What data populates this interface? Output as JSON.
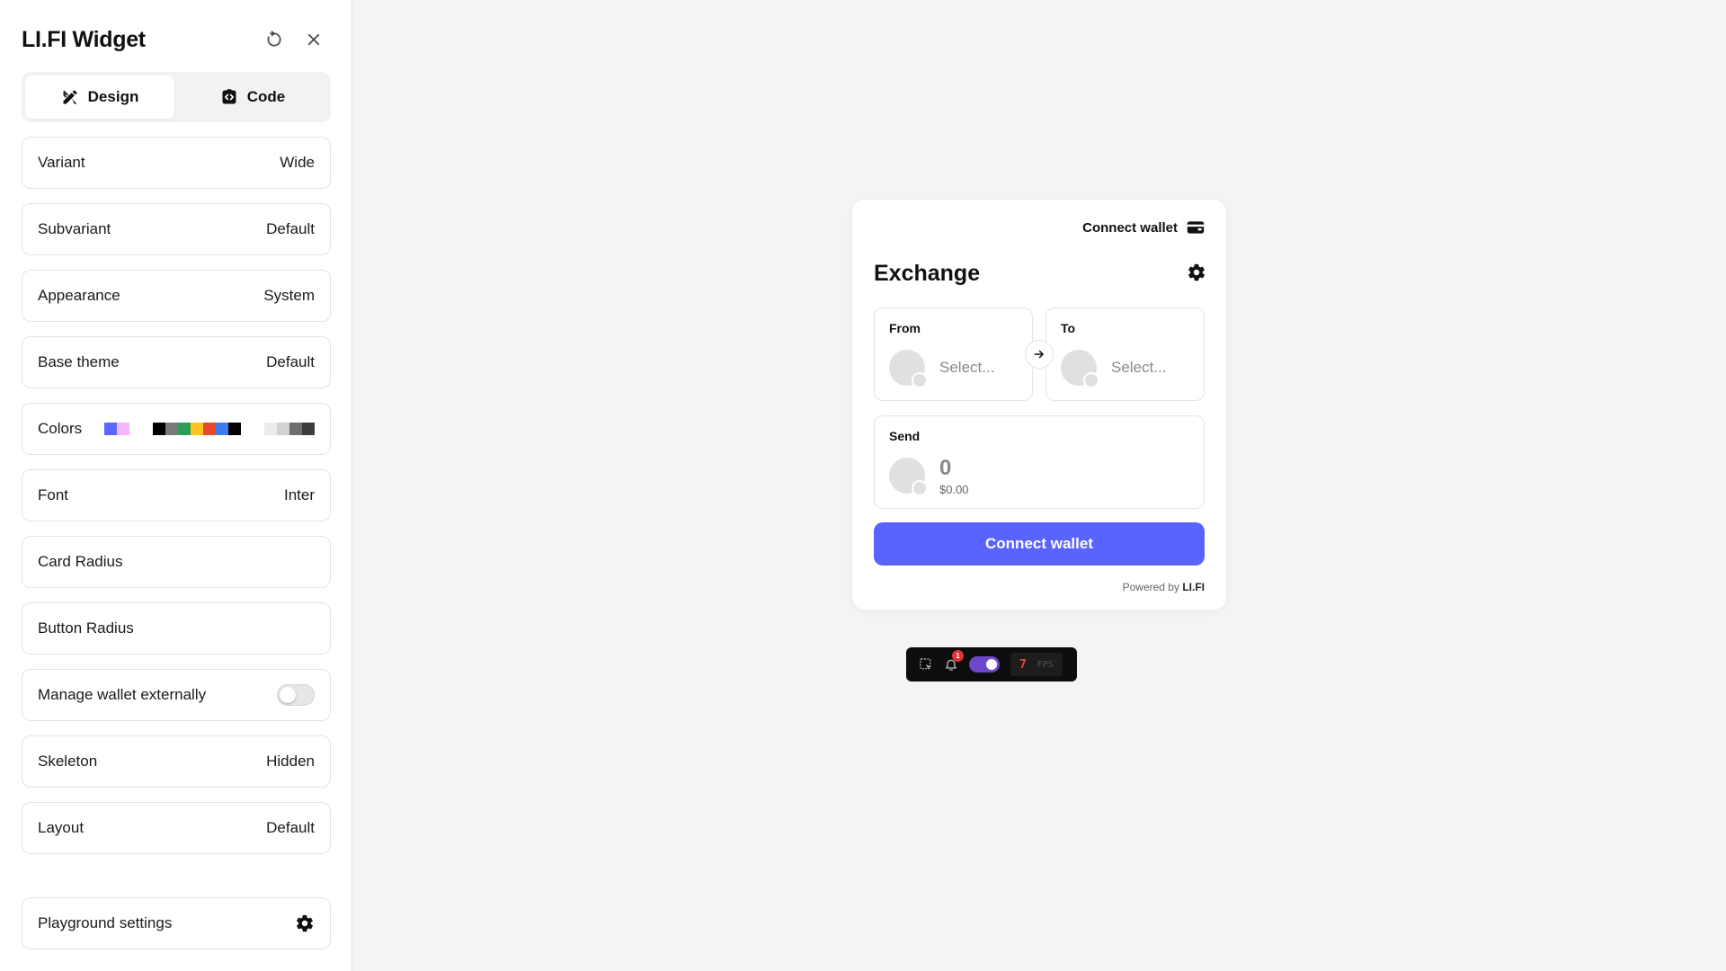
{
  "sidebar": {
    "title": "LI.FI Widget",
    "tabs": [
      {
        "label": "Design",
        "icon": "pencil-ruler-icon",
        "active": true
      },
      {
        "label": "Code",
        "icon": "code-icon",
        "active": false
      }
    ],
    "options": {
      "variant": {
        "label": "Variant",
        "value": "Wide"
      },
      "subvariant": {
        "label": "Subvariant",
        "value": "Default"
      },
      "appearance": {
        "label": "Appearance",
        "value": "System"
      },
      "base_theme": {
        "label": "Base theme",
        "value": "Default"
      },
      "colors": {
        "label": "Colors",
        "groups": [
          [
            "#5c67ff",
            "#f5b5ff"
          ],
          [
            "#000000",
            "#7a7a7a",
            "#2e9e57",
            "#ffc31f",
            "#e34b2c",
            "#3f7bf0",
            "#000000"
          ],
          [
            "#ececec",
            "#d2d2d2",
            "#6e6e6e",
            "#3c3c3c"
          ]
        ]
      },
      "font": {
        "label": "Font",
        "value": "Inter"
      },
      "card_radius": {
        "label": "Card Radius"
      },
      "button_radius": {
        "label": "Button Radius"
      },
      "manage_wallet": {
        "label": "Manage wallet externally",
        "enabled": false
      },
      "skeleton": {
        "label": "Skeleton",
        "value": "Hidden"
      },
      "layout": {
        "label": "Layout",
        "value": "Default"
      },
      "playground": {
        "label": "Playground settings"
      }
    }
  },
  "widget": {
    "connect_top": "Connect wallet",
    "title": "Exchange",
    "from": {
      "label": "From",
      "placeholder": "Select..."
    },
    "to": {
      "label": "To",
      "placeholder": "Select..."
    },
    "send": {
      "label": "Send",
      "amount": "0",
      "usd": "$0.00"
    },
    "connect_button": "Connect wallet",
    "powered_prefix": "Powered by",
    "powered_brand": "LI.FI",
    "accent": "#5b63fe"
  },
  "devbar": {
    "notifications": "1",
    "fps_value": "7",
    "fps_label": "FPS"
  }
}
